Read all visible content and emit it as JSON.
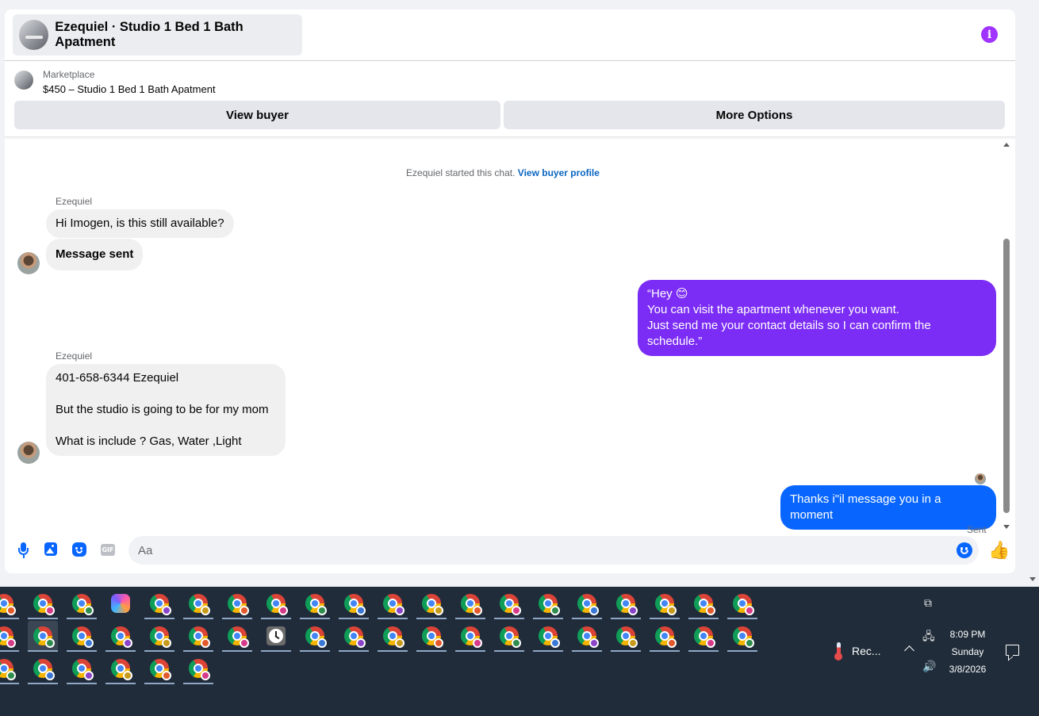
{
  "header": {
    "title": "Ezequiel · Studio 1 Bed 1 Bath Apatment",
    "info_icon": "info-icon",
    "info_glyph": "i",
    "accent_color": "#a033ff"
  },
  "listing": {
    "label": "Marketplace",
    "title": "$450 – Studio 1 Bed 1 Bath Apatment",
    "buttons": {
      "view_buyer": "View buyer",
      "more_options": "More Options"
    }
  },
  "chat": {
    "system_note": "Ezequiel started this chat.",
    "system_link": "View buyer profile",
    "groups": [
      {
        "sender": "Ezequiel",
        "messages": [
          "Hi Imogen, is this still available?",
          "Message sent"
        ]
      },
      {
        "direction": "out",
        "lines": [
          "“Hey 😊",
          "You can visit the apartment whenever you want.",
          "Just send me your contact details so I can confirm the schedule.”"
        ]
      },
      {
        "sender": "Ezequiel",
        "lines": [
          "401-658-6344 Ezequiel",
          "",
          "But the studio is going to be for my mom",
          "",
          "What is include ? Gas, Water ,Light"
        ]
      },
      {
        "direction": "out",
        "message": "Thanks i\"il message you in a moment",
        "status": "Sent"
      }
    ]
  },
  "composer": {
    "placeholder": "Aa",
    "value": "",
    "icons": [
      "microphone-icon",
      "photo-icon",
      "sticker-icon",
      "gif-icon",
      "emoji-icon",
      "like-icon"
    ],
    "gif_label": "GIF",
    "like_glyph": "👍"
  },
  "colors": {
    "outgoing_purple": "#7b2cf5",
    "outgoing_blue": "#0866ff",
    "incoming": "#f0f0f0",
    "link": "#0a66c2",
    "taskbar": "#202c3a"
  },
  "taskbar": {
    "rows": [
      [
        "chrome",
        "chrome",
        "chrome",
        "copilot",
        "chrome",
        "chrome",
        "chrome",
        "chrome",
        "chrome",
        "chrome",
        "chrome",
        "chrome",
        "chrome",
        "chrome",
        "chrome",
        "chrome",
        "chrome",
        "chrome",
        "chrome",
        "chrome"
      ],
      [
        "chrome",
        "chrome",
        "chrome",
        "chrome",
        "chrome",
        "chrome",
        "chrome",
        "clock",
        "chrome",
        "chrome",
        "chrome",
        "chrome",
        "chrome",
        "chrome",
        "chrome",
        "chrome",
        "chrome",
        "chrome",
        "chrome",
        "chrome"
      ],
      [
        "chrome",
        "chrome",
        "chrome",
        "chrome",
        "chrome",
        "chrome"
      ]
    ],
    "tray": {
      "app_label": "Rec...",
      "time": "8:09 PM",
      "day": "Sunday",
      "date": "3/8/2026"
    }
  }
}
